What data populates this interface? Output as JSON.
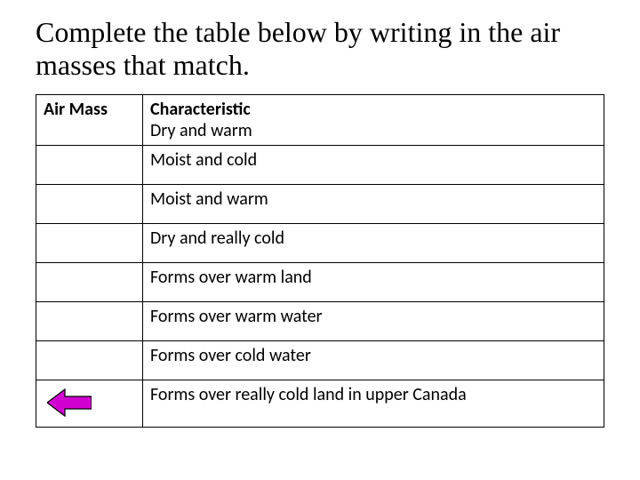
{
  "title": "Complete the table below by writing in the air masses that match.",
  "table": {
    "header": {
      "col1": "Air Mass",
      "col2": "Characteristic",
      "col2sub": "Dry and warm"
    },
    "rows": [
      {
        "airmass": "",
        "characteristic": "Moist and cold"
      },
      {
        "airmass": "",
        "characteristic": "Moist and warm"
      },
      {
        "airmass": "",
        "characteristic": "Dry and really cold"
      },
      {
        "airmass": "",
        "characteristic": "Forms over warm land"
      },
      {
        "airmass": "",
        "characteristic": "Forms over warm water"
      },
      {
        "airmass": "",
        "characteristic": "Forms over cold water"
      },
      {
        "airmass": "",
        "characteristic": "Forms over really cold land in upper Canada"
      }
    ]
  },
  "icons": {
    "back_arrow": "back-arrow-icon"
  },
  "colors": {
    "arrow_fill": "#d100d1",
    "arrow_stroke": "#000000"
  }
}
